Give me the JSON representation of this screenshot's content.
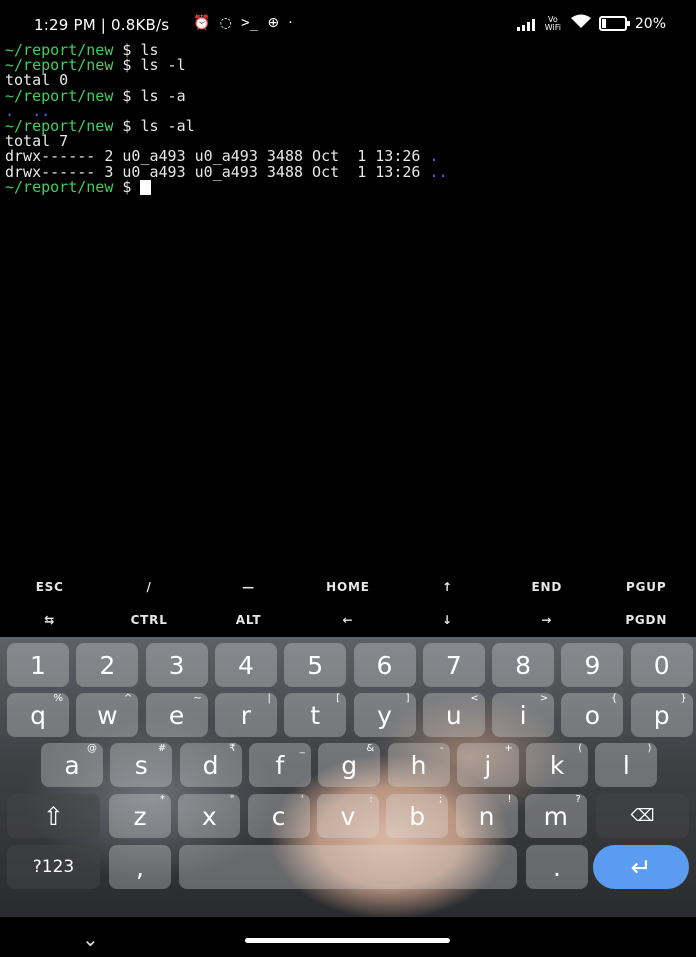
{
  "status_bar": {
    "time_speed": "1:29 PM | 0.8KB/s",
    "icons": [
      "alarm-icon",
      "whatsapp-icon",
      "terminal-icon",
      "data-saver-icon",
      "dot-icon"
    ],
    "volte": "Vo WiFi",
    "battery": "20%"
  },
  "terminal": {
    "prompt": "~/report/new",
    "dollar": "$",
    "lines": [
      {
        "type": "cmd",
        "cmd": "ls"
      },
      {
        "type": "cmd",
        "cmd": "ls -l"
      },
      {
        "type": "out",
        "text": "total 0"
      },
      {
        "type": "cmd",
        "cmd": "ls -a"
      },
      {
        "type": "dots",
        "text": ".  .."
      },
      {
        "type": "cmd",
        "cmd": "ls -al"
      },
      {
        "type": "out",
        "text": "total 7"
      },
      {
        "type": "ls",
        "text": "drwx------ 2 u0_a493 u0_a493 3488 Oct  1 13:26 ",
        "name": "."
      },
      {
        "type": "ls",
        "text": "drwx------ 3 u0_a493 u0_a493 3488 Oct  1 13:26 ",
        "name": ".."
      },
      {
        "type": "input",
        "cmd": ""
      }
    ]
  },
  "extra_keys": {
    "row1": [
      "ESC",
      "/",
      "—",
      "HOME",
      "↑",
      "END",
      "PGUP"
    ],
    "row2": [
      "⇆",
      "CTRL",
      "ALT",
      "←",
      "↓",
      "→",
      "PGDN"
    ]
  },
  "keyboard": {
    "numbers": [
      "1",
      "2",
      "3",
      "4",
      "5",
      "6",
      "7",
      "8",
      "9",
      "0"
    ],
    "row_q": [
      [
        "q",
        "%"
      ],
      [
        "w",
        "^"
      ],
      [
        "e",
        "~"
      ],
      [
        "r",
        "|"
      ],
      [
        "t",
        "["
      ],
      [
        "y",
        "]"
      ],
      [
        "u",
        "<"
      ],
      [
        "i",
        ">"
      ],
      [
        "o",
        "{"
      ],
      [
        "p",
        "}"
      ]
    ],
    "row_a": [
      [
        "a",
        "@"
      ],
      [
        "s",
        "#"
      ],
      [
        "d",
        "₹"
      ],
      [
        "f",
        "_"
      ],
      [
        "g",
        "&"
      ],
      [
        "h",
        "-"
      ],
      [
        "j",
        "+"
      ],
      [
        "k",
        "("
      ],
      [
        "l",
        ")"
      ]
    ],
    "row_z": [
      [
        "z",
        "*"
      ],
      [
        "x",
        "\""
      ],
      [
        "c",
        "'"
      ],
      [
        "v",
        ":"
      ],
      [
        "b",
        ";"
      ],
      [
        "n",
        "!"
      ],
      [
        "m",
        "?"
      ]
    ],
    "shift": "⇧",
    "backspace": "⌫",
    "symbols": "?123",
    "comma": ",",
    "period": ".",
    "enter": "↵"
  },
  "nav": {
    "chevron": "⌄"
  }
}
